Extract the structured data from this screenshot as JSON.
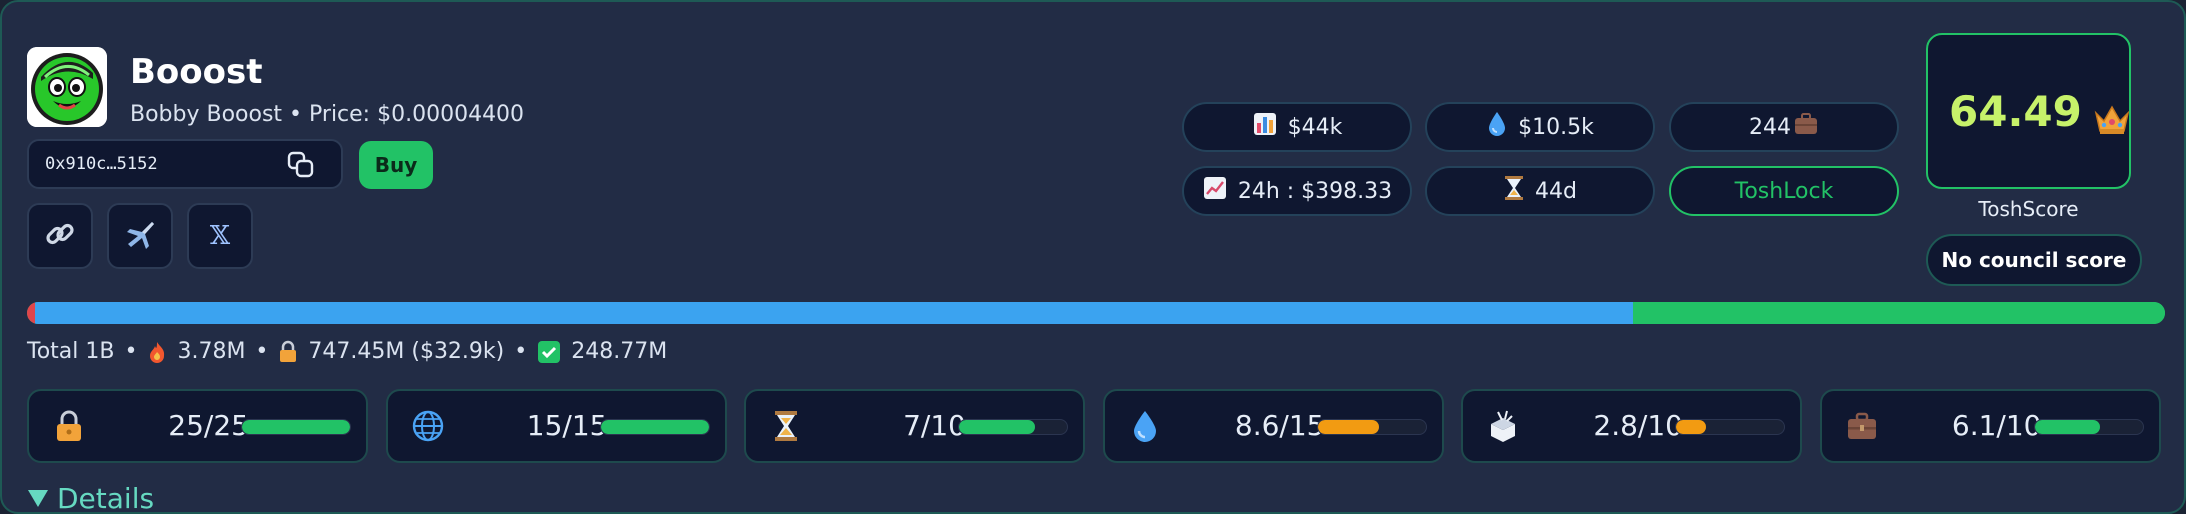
{
  "token": {
    "name": "Booost",
    "subtitle": "Bobby Booost • Price: $0.00004400",
    "address": "0x910c…5152",
    "buy_label": "Buy"
  },
  "socials": [
    {
      "name": "link-icon"
    },
    {
      "name": "telegram-icon"
    },
    {
      "name": "x-icon",
      "label": "𝕏"
    }
  ],
  "stats": {
    "market_cap": "$44k",
    "liquidity": "$10.5k",
    "holders": "244",
    "volume_24h": "24h : $398.33",
    "age": "44d",
    "toshlock": "ToshLock"
  },
  "score": {
    "value": "64.49",
    "label": "ToshScore",
    "council": "No council score"
  },
  "supply": {
    "total": "Total 1B",
    "burned": "3.78M",
    "locked": "747.45M ($32.9k)",
    "circulating": "248.77M",
    "segments": [
      {
        "name": "burned",
        "fraction": 0.0038,
        "color": "#e0454b"
      },
      {
        "name": "locked",
        "fraction": 0.7475,
        "color": "#3ba3f0"
      },
      {
        "name": "circulating",
        "fraction": 0.2488,
        "color": "#22c266"
      }
    ]
  },
  "metrics": [
    {
      "name": "lock",
      "icon": "lock-icon",
      "value": "25/25",
      "fraction": 1.0,
      "color": "#22c266"
    },
    {
      "name": "globe",
      "icon": "globe-icon",
      "value": "15/15",
      "fraction": 1.0,
      "color": "#22c266"
    },
    {
      "name": "age",
      "icon": "hourglass-icon",
      "value": "7/10",
      "fraction": 0.7,
      "color": "#22c266"
    },
    {
      "name": "liquidity",
      "icon": "droplet-icon",
      "value": "8.6/15",
      "fraction": 0.573,
      "color": "#f29b12"
    },
    {
      "name": "distribution",
      "icon": "box-icon",
      "value": "2.8/10",
      "fraction": 0.28,
      "color": "#f29b12"
    },
    {
      "name": "holders",
      "icon": "briefcase-icon",
      "value": "6.1/10",
      "fraction": 0.61,
      "color": "#22c266"
    }
  ],
  "details_label": "Details"
}
